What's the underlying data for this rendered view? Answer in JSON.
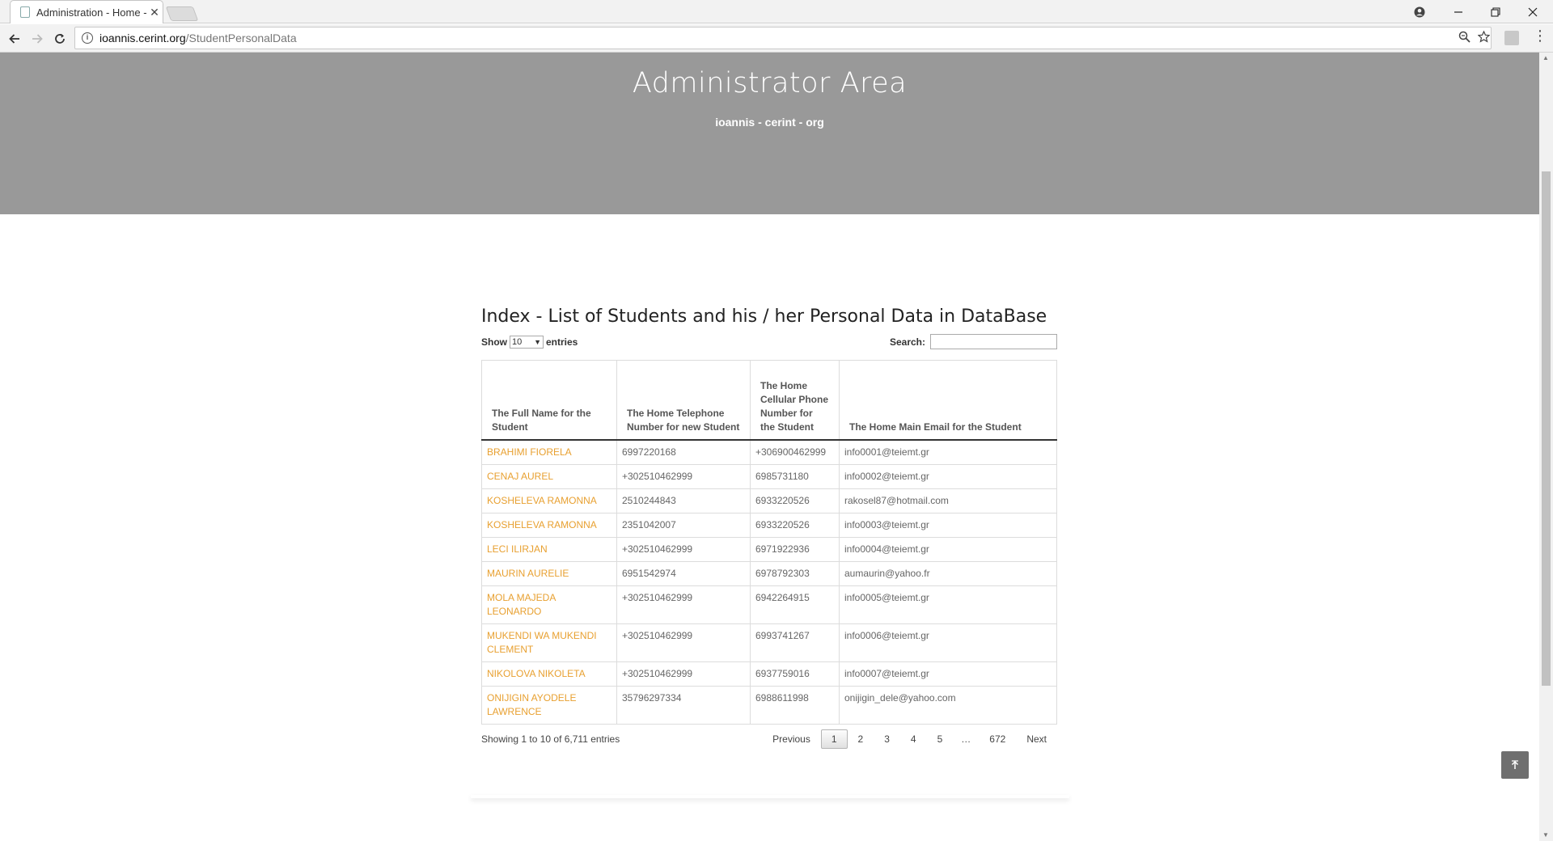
{
  "browser": {
    "tab_title": "Administration - Home -",
    "tab_close": "✕",
    "url_host": "ioannis.cerint.org",
    "url_path": "/StudentPersonalData"
  },
  "hero": {
    "title": "Administrator Area",
    "subtitle": "ioannis - cerint - org",
    "background_color": "#999999"
  },
  "main": {
    "heading": "Index - List of Students and his / her Personal Data in DataBase",
    "length": {
      "show_label": "Show",
      "value": "10",
      "entries_label": "entries"
    },
    "search_label": "Search:",
    "columns": [
      "The Full Name for the Student",
      "The Home Telephone Number for new Student",
      "The Home Cellular Phone Number for the Student",
      "The Home Main Email for the Student"
    ],
    "rows": [
      {
        "name": "BRAHIMI FIORELA",
        "telephone": "6997220168",
        "cellular": "+306900462999",
        "email": "info0001@teiemt.gr"
      },
      {
        "name": "CENAJ AUREL",
        "telephone": "+302510462999",
        "cellular": "6985731180",
        "email": "info0002@teiemt.gr"
      },
      {
        "name": "KOSHELEVA RAMONNA",
        "telephone": "2510244843",
        "cellular": "6933220526",
        "email": "rakosel87@hotmail.com"
      },
      {
        "name": "KOSHELEVA RAMONNA",
        "telephone": "2351042007",
        "cellular": "6933220526",
        "email": "info0003@teiemt.gr"
      },
      {
        "name": "LECI ILIRJAN",
        "telephone": "+302510462999",
        "cellular": "6971922936",
        "email": "info0004@teiemt.gr"
      },
      {
        "name": "MAURIN AURELIE",
        "telephone": "6951542974",
        "cellular": "6978792303",
        "email": "aumaurin@yahoo.fr"
      },
      {
        "name": "MOLA MAJEDA LEONARDO",
        "telephone": "+302510462999",
        "cellular": "6942264915",
        "email": "info0005@teiemt.gr"
      },
      {
        "name": "MUKENDI WA MUKENDI CLEMENT",
        "telephone": "+302510462999",
        "cellular": "6993741267",
        "email": "info0006@teiemt.gr"
      },
      {
        "name": "NIKOLOVA NIKOLETA",
        "telephone": "+302510462999",
        "cellular": "6937759016",
        "email": "info0007@teiemt.gr"
      },
      {
        "name": "ONIJIGIN AYODELE LAWRENCE",
        "telephone": "35796297334",
        "cellular": "6988611998",
        "email": "onijigin_dele@yahoo.com"
      }
    ],
    "info": "Showing 1 to 10 of 6,711 entries",
    "pagination": {
      "previous": "Previous",
      "pages": [
        "1",
        "2",
        "3",
        "4",
        "5"
      ],
      "ellipsis": "…",
      "last": "672",
      "next": "Next",
      "current": "1"
    }
  },
  "colors": {
    "link": "#e8a030",
    "hero": "#999999"
  },
  "icons": {
    "back": "back-arrow-icon",
    "forward": "forward-arrow-icon",
    "reload": "reload-icon",
    "to_top": "arrow-up-icon"
  }
}
